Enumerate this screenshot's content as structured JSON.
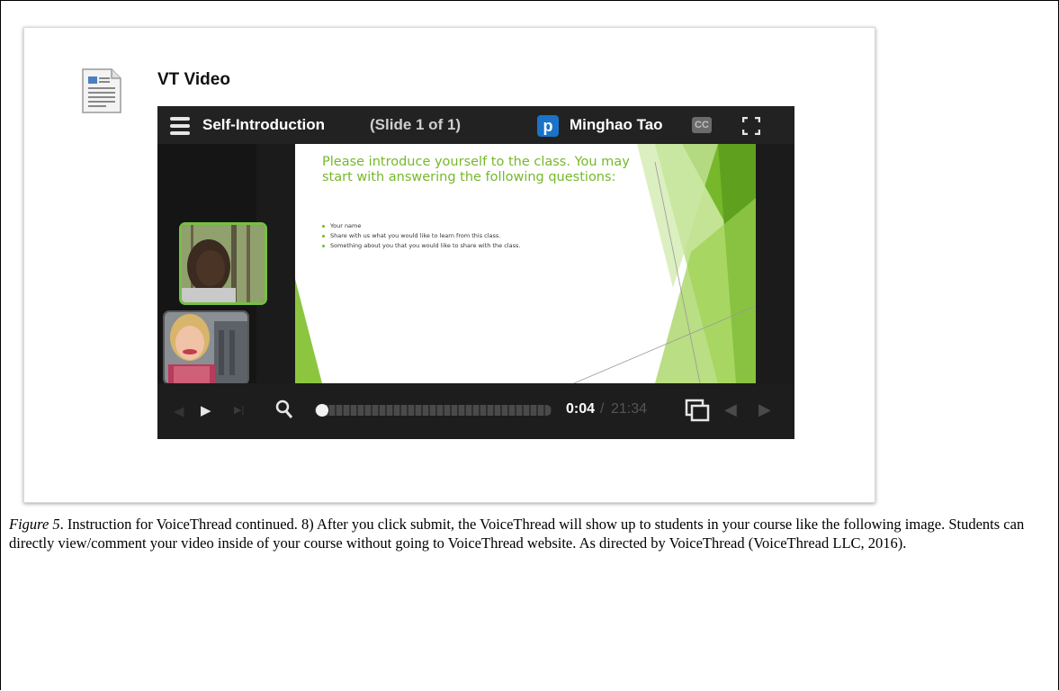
{
  "card": {
    "item_title": "VT Video",
    "icon": "document-icon"
  },
  "player": {
    "thread_title": "Self-Introduction",
    "slide_count": "(Slide 1 of 1)",
    "user_badge": "p",
    "user_name": "Minghao Tao",
    "cc_label": "CC",
    "slide": {
      "heading": "Please introduce yourself to the class. You may start with answering the following questions:",
      "bullets": [
        "Your name",
        "Share with us what you would like to learn from this class.",
        "Something about you that you would like to share with the class."
      ],
      "accent_color": "#76b82a"
    },
    "controls": {
      "time_current": "0:04",
      "time_separator": "/",
      "time_total": "21:34",
      "progress_fraction": 0.003
    }
  },
  "caption": {
    "figure_label": "Figure 5",
    "text": ". Instruction for VoiceThread continued. 8) After you click submit, the VoiceThread will show up to students in your course like the following image. Students can directly view/comment your video inside of your course without going to VoiceThread website. As directed by VoiceThread (VoiceThread LLC, 2016)."
  }
}
